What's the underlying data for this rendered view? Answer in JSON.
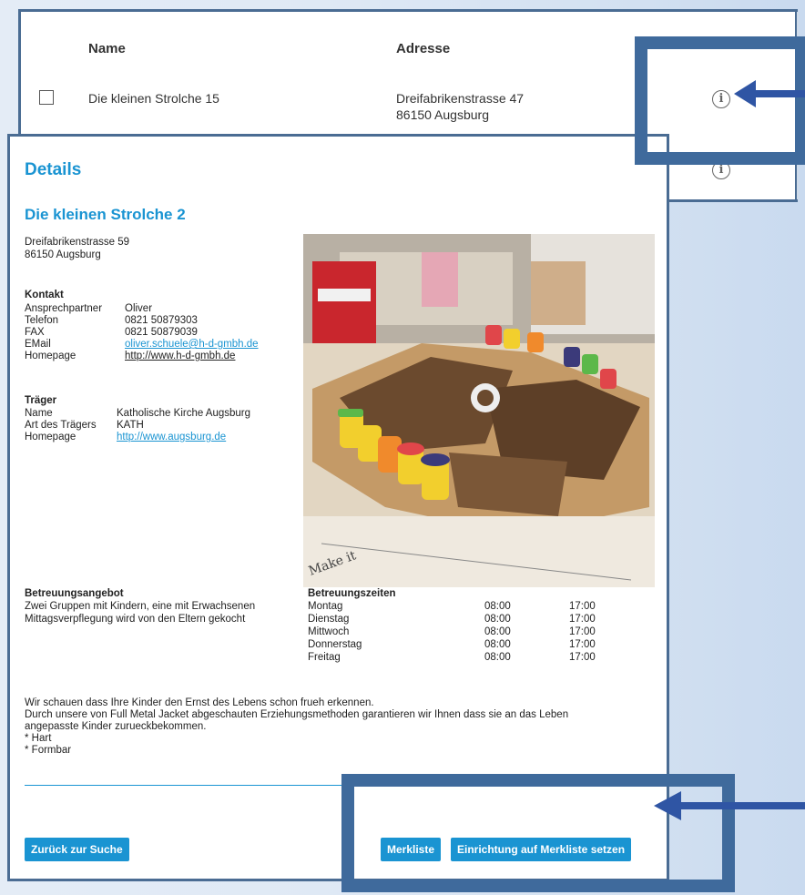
{
  "table": {
    "col_name": "Name",
    "col_address": "Adresse",
    "row1": {
      "name": "Die kleinen Strolche 15",
      "street": "Dreifabrikenstrasse 47",
      "city": "86150 Augsburg"
    }
  },
  "details": {
    "heading": "Details",
    "facility_name": "Die kleinen Strolche 2",
    "street": "Dreifabrikenstrasse 59",
    "city": "86150 Augsburg",
    "contact": {
      "heading": "Kontakt",
      "labels": {
        "person": "Ansprechpartner",
        "phone": "Telefon",
        "fax": "FAX",
        "email": "EMail",
        "homepage": "Homepage"
      },
      "person": "Oliver",
      "phone": "0821 50879303",
      "fax": "0821 50879039",
      "email": "oliver.schuele@h-d-gmbh.de",
      "homepage": "http://www.h-d-gmbh.de"
    },
    "carrier": {
      "heading": "Träger",
      "labels": {
        "name": "Name",
        "type": "Art des Trägers",
        "homepage": "Homepage"
      },
      "name": "Katholische Kirche Augsburg",
      "type": "KATH",
      "homepage": "http://www.augsburg.de"
    },
    "offer": {
      "heading": "Betreuungsangebot",
      "line1": "Zwei Gruppen mit Kindern, eine mit Erwachsenen",
      "line2": "Mittagsverpflegung wird von den Eltern gekocht"
    },
    "hours": {
      "heading": "Betreuungszeiten",
      "rows": [
        {
          "day": "Montag",
          "from": "08:00",
          "to": "17:00"
        },
        {
          "day": "Dienstag",
          "from": "08:00",
          "to": "17:00"
        },
        {
          "day": "Mittwoch",
          "from": "08:00",
          "to": "17:00"
        },
        {
          "day": "Donnerstag",
          "from": "08:00",
          "to": "17:00"
        },
        {
          "day": "Freitag",
          "from": "08:00",
          "to": "17:00"
        }
      ]
    },
    "description": {
      "line1": "Wir schauen dass Ihre Kinder den Ernst des Lebens schon frueh erkennen.",
      "line2": "Durch unsere von Full Metal Jacket abgeschauten Erziehungsmethoden garantieren wir Ihnen dass sie an das Leben",
      "line3": "angepasste Kinder zurueckbekommen.",
      "line4": "* Hart",
      "line5": "* Formbar"
    },
    "photo_text": "Make it"
  },
  "buttons": {
    "back": "Zurück zur Suche",
    "watchlist": "Merkliste",
    "add_watchlist": "Einrichtung auf Merkliste setzen"
  },
  "icons": {
    "info": "i",
    "info_icon_name": "info-circle-icon"
  },
  "colors": {
    "accent": "#1a94d2",
    "highlight": "#3f6a9c",
    "arrow": "#2f55a4"
  }
}
